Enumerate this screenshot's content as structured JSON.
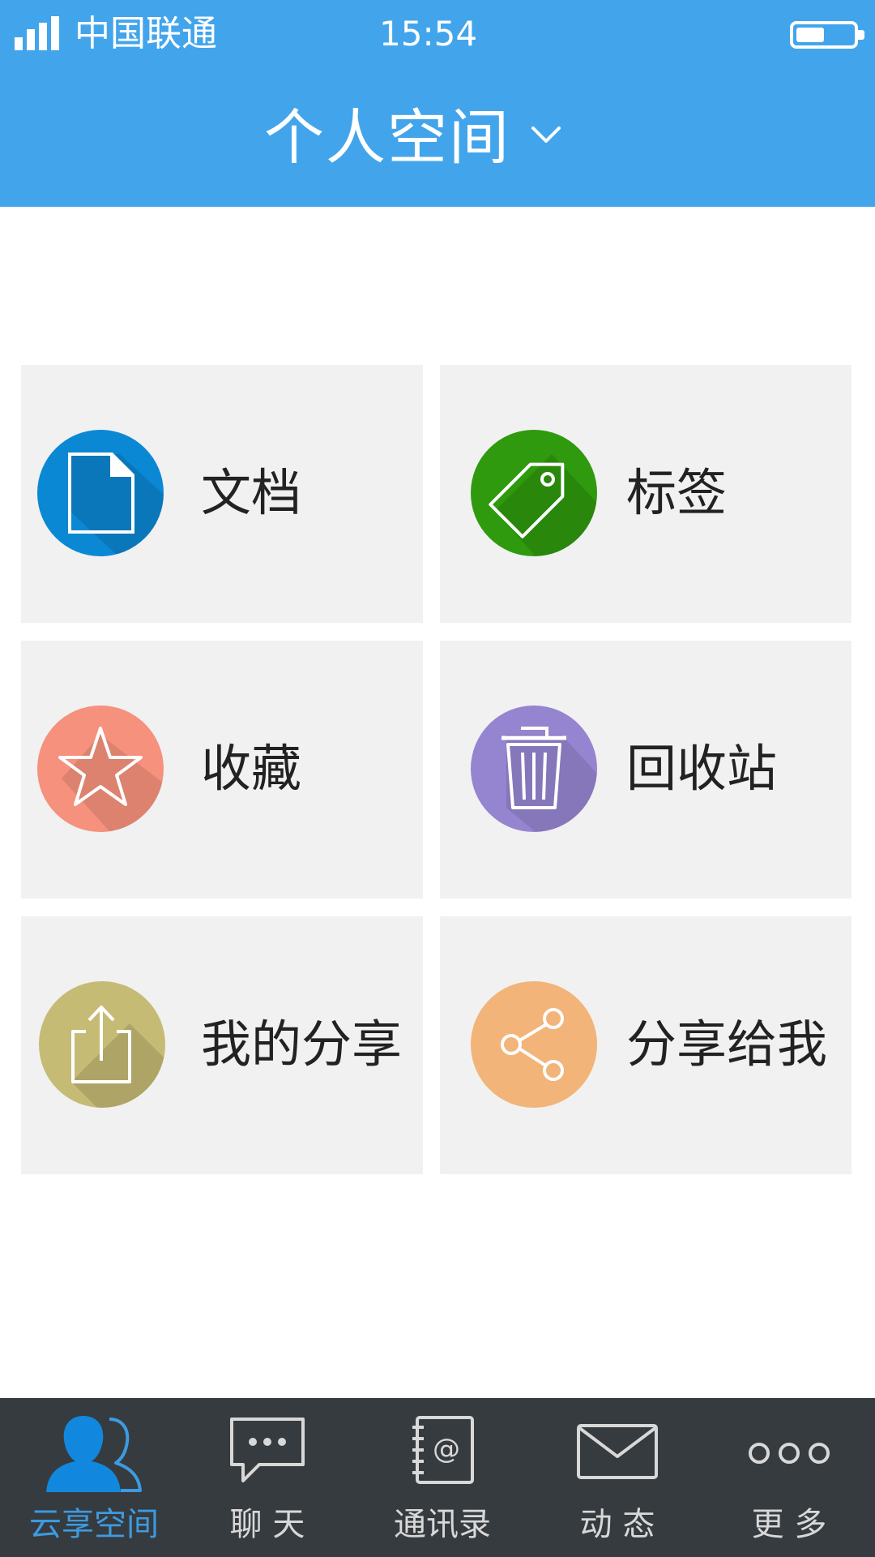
{
  "status_bar": {
    "carrier": "中国联通",
    "time": "15:54",
    "signal_icon": "signal-bars-icon",
    "battery_icon": "battery-icon"
  },
  "header": {
    "title": "个人空间",
    "dropdown_icon": "chevron-down-icon",
    "background_color": "#42a5ec"
  },
  "grid": {
    "tiles": [
      {
        "label": "文档",
        "icon": "document-icon",
        "color": "#0b88d4"
      },
      {
        "label": "标签",
        "icon": "tag-icon",
        "color": "#2f9a0d"
      },
      {
        "label": "收藏",
        "icon": "star-icon",
        "color": "#f5917c"
      },
      {
        "label": "回收站",
        "icon": "trash-icon",
        "color": "#9585d0"
      },
      {
        "label": "我的分享",
        "icon": "share-out-icon",
        "color": "#c6bb75"
      },
      {
        "label": "分享给我",
        "icon": "share-nodes-icon",
        "color": "#f2b478"
      }
    ]
  },
  "tabbar": {
    "active_color": "#3d9be0",
    "tabs": [
      {
        "label": "云享空间",
        "icon": "users-icon",
        "active": true
      },
      {
        "label": "聊 天",
        "icon": "chat-bubble-icon",
        "active": false
      },
      {
        "label": "通讯录",
        "icon": "address-book-icon",
        "active": false
      },
      {
        "label": "动 态",
        "icon": "envelope-icon",
        "active": false
      },
      {
        "label": "更 多",
        "icon": "more-dots-icon",
        "active": false
      }
    ]
  }
}
